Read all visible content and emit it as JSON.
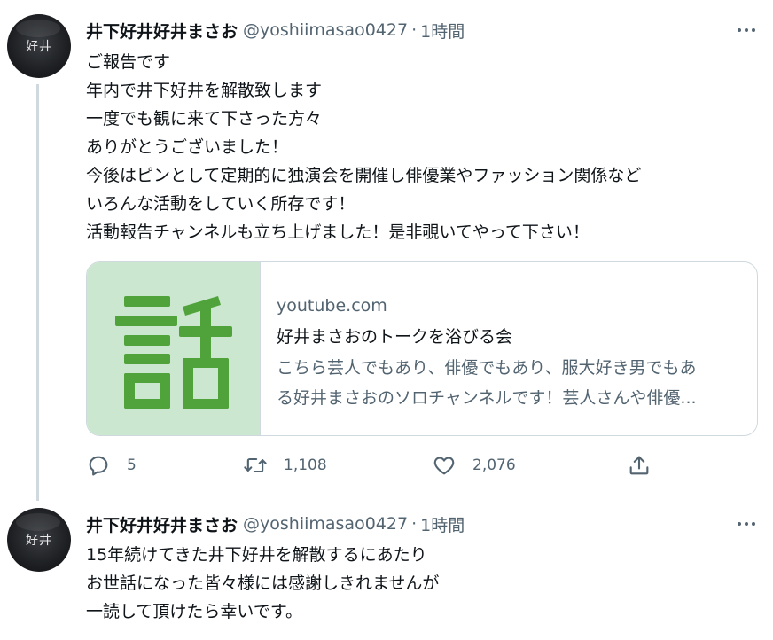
{
  "tweet1": {
    "avatar_text": "好井",
    "name": "井下好井好井まさお",
    "handle": "@yoshiimasao0427",
    "separator": "·",
    "time": "1時間",
    "lines": [
      "ご報告です",
      "年内で井下好井を解散致します",
      "一度でも観に来て下さった方々",
      "ありがとうございました！",
      "今後はピンとして定期的に独演会を開催し俳優業やファッション関係など",
      "いろんな活動をしていく所存です！",
      "活動報告チャンネルも立ち上げました！是非覗いてやって下さい！"
    ],
    "card": {
      "thumb_glyph": "話",
      "domain": "youtube.com",
      "title": "好井まさおのトークを浴びる会",
      "desc_lines": [
        "こちら芸人でもあり、俳優でもあり、服大好き男でもあ",
        "る好井まさおのソロチャンネルです！芸人さんや俳優..."
      ]
    },
    "actions": {
      "replies": "5",
      "retweets": "1,108",
      "likes": "2,076"
    }
  },
  "tweet2": {
    "avatar_text": "好井",
    "name": "井下好井好井まさお",
    "handle": "@yoshiimasao0427",
    "separator": "·",
    "time": "1時間",
    "lines": [
      "15年続けてきた井下好井を解散するにあたり",
      "お世話になった皆々様には感謝しきれませんが",
      "一読して頂けたら幸いです。"
    ]
  },
  "colors": {
    "text": "#0f1419",
    "secondary": "#536471",
    "thread_line": "#cfd9de",
    "thumb_bg": "#cbe7cf",
    "thumb_glyph": "#4fa33a"
  },
  "icons": [
    "reply-icon",
    "retweet-icon",
    "like-icon",
    "share-icon",
    "more-icon"
  ]
}
